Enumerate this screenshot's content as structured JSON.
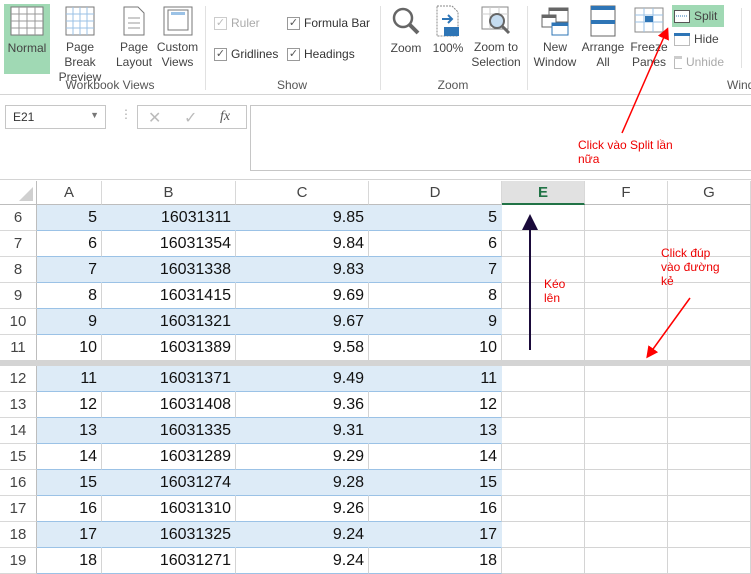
{
  "ribbon": {
    "workbook_views": {
      "label": "Workbook Views",
      "buttons": [
        {
          "label": "Normal",
          "active": true
        },
        {
          "label": "Page Break Preview"
        },
        {
          "label": "Page Layout"
        },
        {
          "label": "Custom Views"
        }
      ]
    },
    "show": {
      "label": "Show",
      "checks": [
        {
          "label": "Ruler",
          "checked": true,
          "disabled": true
        },
        {
          "label": "Formula Bar",
          "checked": true
        },
        {
          "label": "Gridlines",
          "checked": true
        },
        {
          "label": "Headings",
          "checked": true
        }
      ]
    },
    "zoom": {
      "label": "Zoom",
      "buttons": [
        {
          "label": "Zoom"
        },
        {
          "label": "100%"
        },
        {
          "label": "Zoom to Selection"
        }
      ]
    },
    "window": {
      "label": "Wind",
      "buttons": [
        {
          "label": "New Window"
        },
        {
          "label": "Arrange All"
        },
        {
          "label": "Freeze Panes"
        }
      ],
      "split": "Split",
      "hide": "Hide",
      "unhide": "Unhide"
    }
  },
  "formula_bar": {
    "name_box": "E21",
    "fx": "fx",
    "value": ""
  },
  "columns": [
    "A",
    "B",
    "C",
    "D",
    "E",
    "F",
    "G"
  ],
  "selected_column": "E",
  "rows": [
    {
      "n": "6",
      "a": "5",
      "b": "16031311",
      "c": "9.85",
      "d": "5"
    },
    {
      "n": "7",
      "a": "6",
      "b": "16031354",
      "c": "9.84",
      "d": "6"
    },
    {
      "n": "8",
      "a": "7",
      "b": "16031338",
      "c": "9.83",
      "d": "7"
    },
    {
      "n": "9",
      "a": "8",
      "b": "16031415",
      "c": "9.69",
      "d": "8"
    },
    {
      "n": "10",
      "a": "9",
      "b": "16031321",
      "c": "9.67",
      "d": "9"
    },
    {
      "n": "11",
      "a": "10",
      "b": "16031389",
      "c": "9.58",
      "d": "10"
    },
    {
      "n": "12",
      "a": "11",
      "b": "16031371",
      "c": "9.49",
      "d": "11"
    },
    {
      "n": "13",
      "a": "12",
      "b": "16031408",
      "c": "9.36",
      "d": "12"
    },
    {
      "n": "14",
      "a": "13",
      "b": "16031335",
      "c": "9.31",
      "d": "13"
    },
    {
      "n": "15",
      "a": "14",
      "b": "16031289",
      "c": "9.29",
      "d": "14"
    },
    {
      "n": "16",
      "a": "15",
      "b": "16031274",
      "c": "9.28",
      "d": "15"
    },
    {
      "n": "17",
      "a": "16",
      "b": "16031310",
      "c": "9.26",
      "d": "16"
    },
    {
      "n": "18",
      "a": "17",
      "b": "16031325",
      "c": "9.24",
      "d": "17"
    },
    {
      "n": "19",
      "a": "18",
      "b": "16031271",
      "c": "9.24",
      "d": "18"
    }
  ],
  "annotations": {
    "split_note": "Click vào Split lần nữa",
    "drag_note": "Kéo lên",
    "dbl_note": "Click đúp vào đường kẻ"
  },
  "colors": {
    "accent": "#217346",
    "band": "#ddebf7",
    "annotation": "#ff0000",
    "active_button": "#a0d9b4"
  }
}
